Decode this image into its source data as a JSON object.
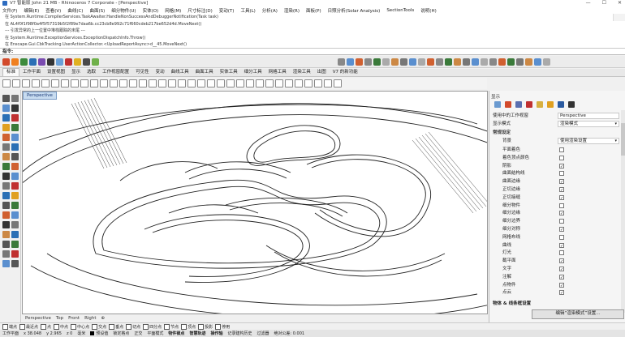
{
  "window": {
    "title": "V7 智能版 John 21 MB - Rhinoceros 7 Corporate - [Perspective]",
    "controls": [
      "—",
      "☐",
      "✕"
    ]
  },
  "menu": [
    "文件(F)",
    "编辑(E)",
    "查看(V)",
    "曲线(C)",
    "曲面(S)",
    "细分物件(U)",
    "实体(O)",
    "网格(M)",
    "尺寸标注(D)",
    "变动(T)",
    "工具(L)",
    "分析(A)",
    "渲染(R)",
    "面板(P)",
    "日照分析(Solar Analysis)",
    "SectionTools",
    "说明(H)"
  ],
  "command_history": [
    "在 System.Runtime.CompilerServices.TaskAwaiter.HandleNonSuccessAndDebuggerNotification(Task task)",
    "在 AL4f0f1f98f0a4f5f57319b5f2f89e7daa6b.cc23cb8e992c71f660cdeb217be652d4d.MoveNext()",
    "--- 引发异常的上一位置中堆栈跟踪的末尾 ---",
    "在 System.Runtime.ExceptionServices.ExceptionDispatchInfo.Throw()",
    "在 Enscape.Gui.CbkTracking.UserActionCollector.<UploadReportAsync>d__45.MoveNext()"
  ],
  "command_prompt": "指令:",
  "toolbar_tabs": [
    "标准",
    "工作平面",
    "设置视图",
    "显示",
    "选取",
    "工作视窗配置",
    "可见性",
    "变动",
    "曲线工具",
    "曲面工具",
    "实体工具",
    "细分工具",
    "网格工具",
    "渲染工具",
    "出图",
    "V7 的新功能"
  ],
  "viewport": {
    "label": "Perspective",
    "tabs": [
      "Perspective",
      "Top",
      "Front",
      "Right",
      "⊕"
    ]
  },
  "osnap": [
    "端点",
    "最近点",
    "点",
    "中点",
    "中心点",
    "交点",
    "垂点",
    "切点",
    "四分点",
    "节点",
    "顶点",
    "投影",
    "停用"
  ],
  "status": {
    "plane": "工作平面",
    "x": "x 38.048",
    "y": "y 2.965",
    "z": "z 0",
    "unit": "毫米",
    "layer": "预设值",
    "items": [
      "锁定格点",
      "正交",
      "平面模式",
      "物件锁点",
      "智慧轨迹",
      "操作轴",
      "记录建构历史",
      "过滤器",
      "绝对公差: 0.001"
    ],
    "active": [
      "物件锁点",
      "智慧轨迹",
      "操作轴"
    ]
  },
  "panel": {
    "header": "显示",
    "rows": [
      {
        "label": "使用中的工作视窗",
        "value": "Perspective"
      },
      {
        "label": "显示模式",
        "value": "渲染模式",
        "dropdown": true
      }
    ],
    "section": "常规设定",
    "bg": {
      "label": "背景",
      "value": "使用渲染设置"
    },
    "checks": [
      {
        "label": "平面着色",
        "on": false
      },
      {
        "label": "着色顶点颜色",
        "on": false
      },
      {
        "label": "阴影",
        "on": true
      },
      {
        "label": "曲面结构线",
        "on": false
      },
      {
        "label": "曲面边缘",
        "on": true
      },
      {
        "label": "正切边缘",
        "on": true
      },
      {
        "label": "正切接缝",
        "on": true
      },
      {
        "label": "细分物件",
        "on": false
      },
      {
        "label": "细分边缘",
        "on": true
      },
      {
        "label": "细分边界",
        "on": false
      },
      {
        "label": "细分对称",
        "on": true
      },
      {
        "label": "网格布线",
        "on": false
      },
      {
        "label": "曲线",
        "on": true
      },
      {
        "label": "灯光",
        "on": false
      },
      {
        "label": "截平面",
        "on": true
      },
      {
        "label": "文字",
        "on": true
      },
      {
        "label": "注解",
        "on": true
      },
      {
        "label": "点物件",
        "on": true
      },
      {
        "label": "点云",
        "on": true
      }
    ],
    "bottom_section": "物体 & 线条框设置",
    "bottom_button": "编辑“渲染模式”设置..."
  }
}
